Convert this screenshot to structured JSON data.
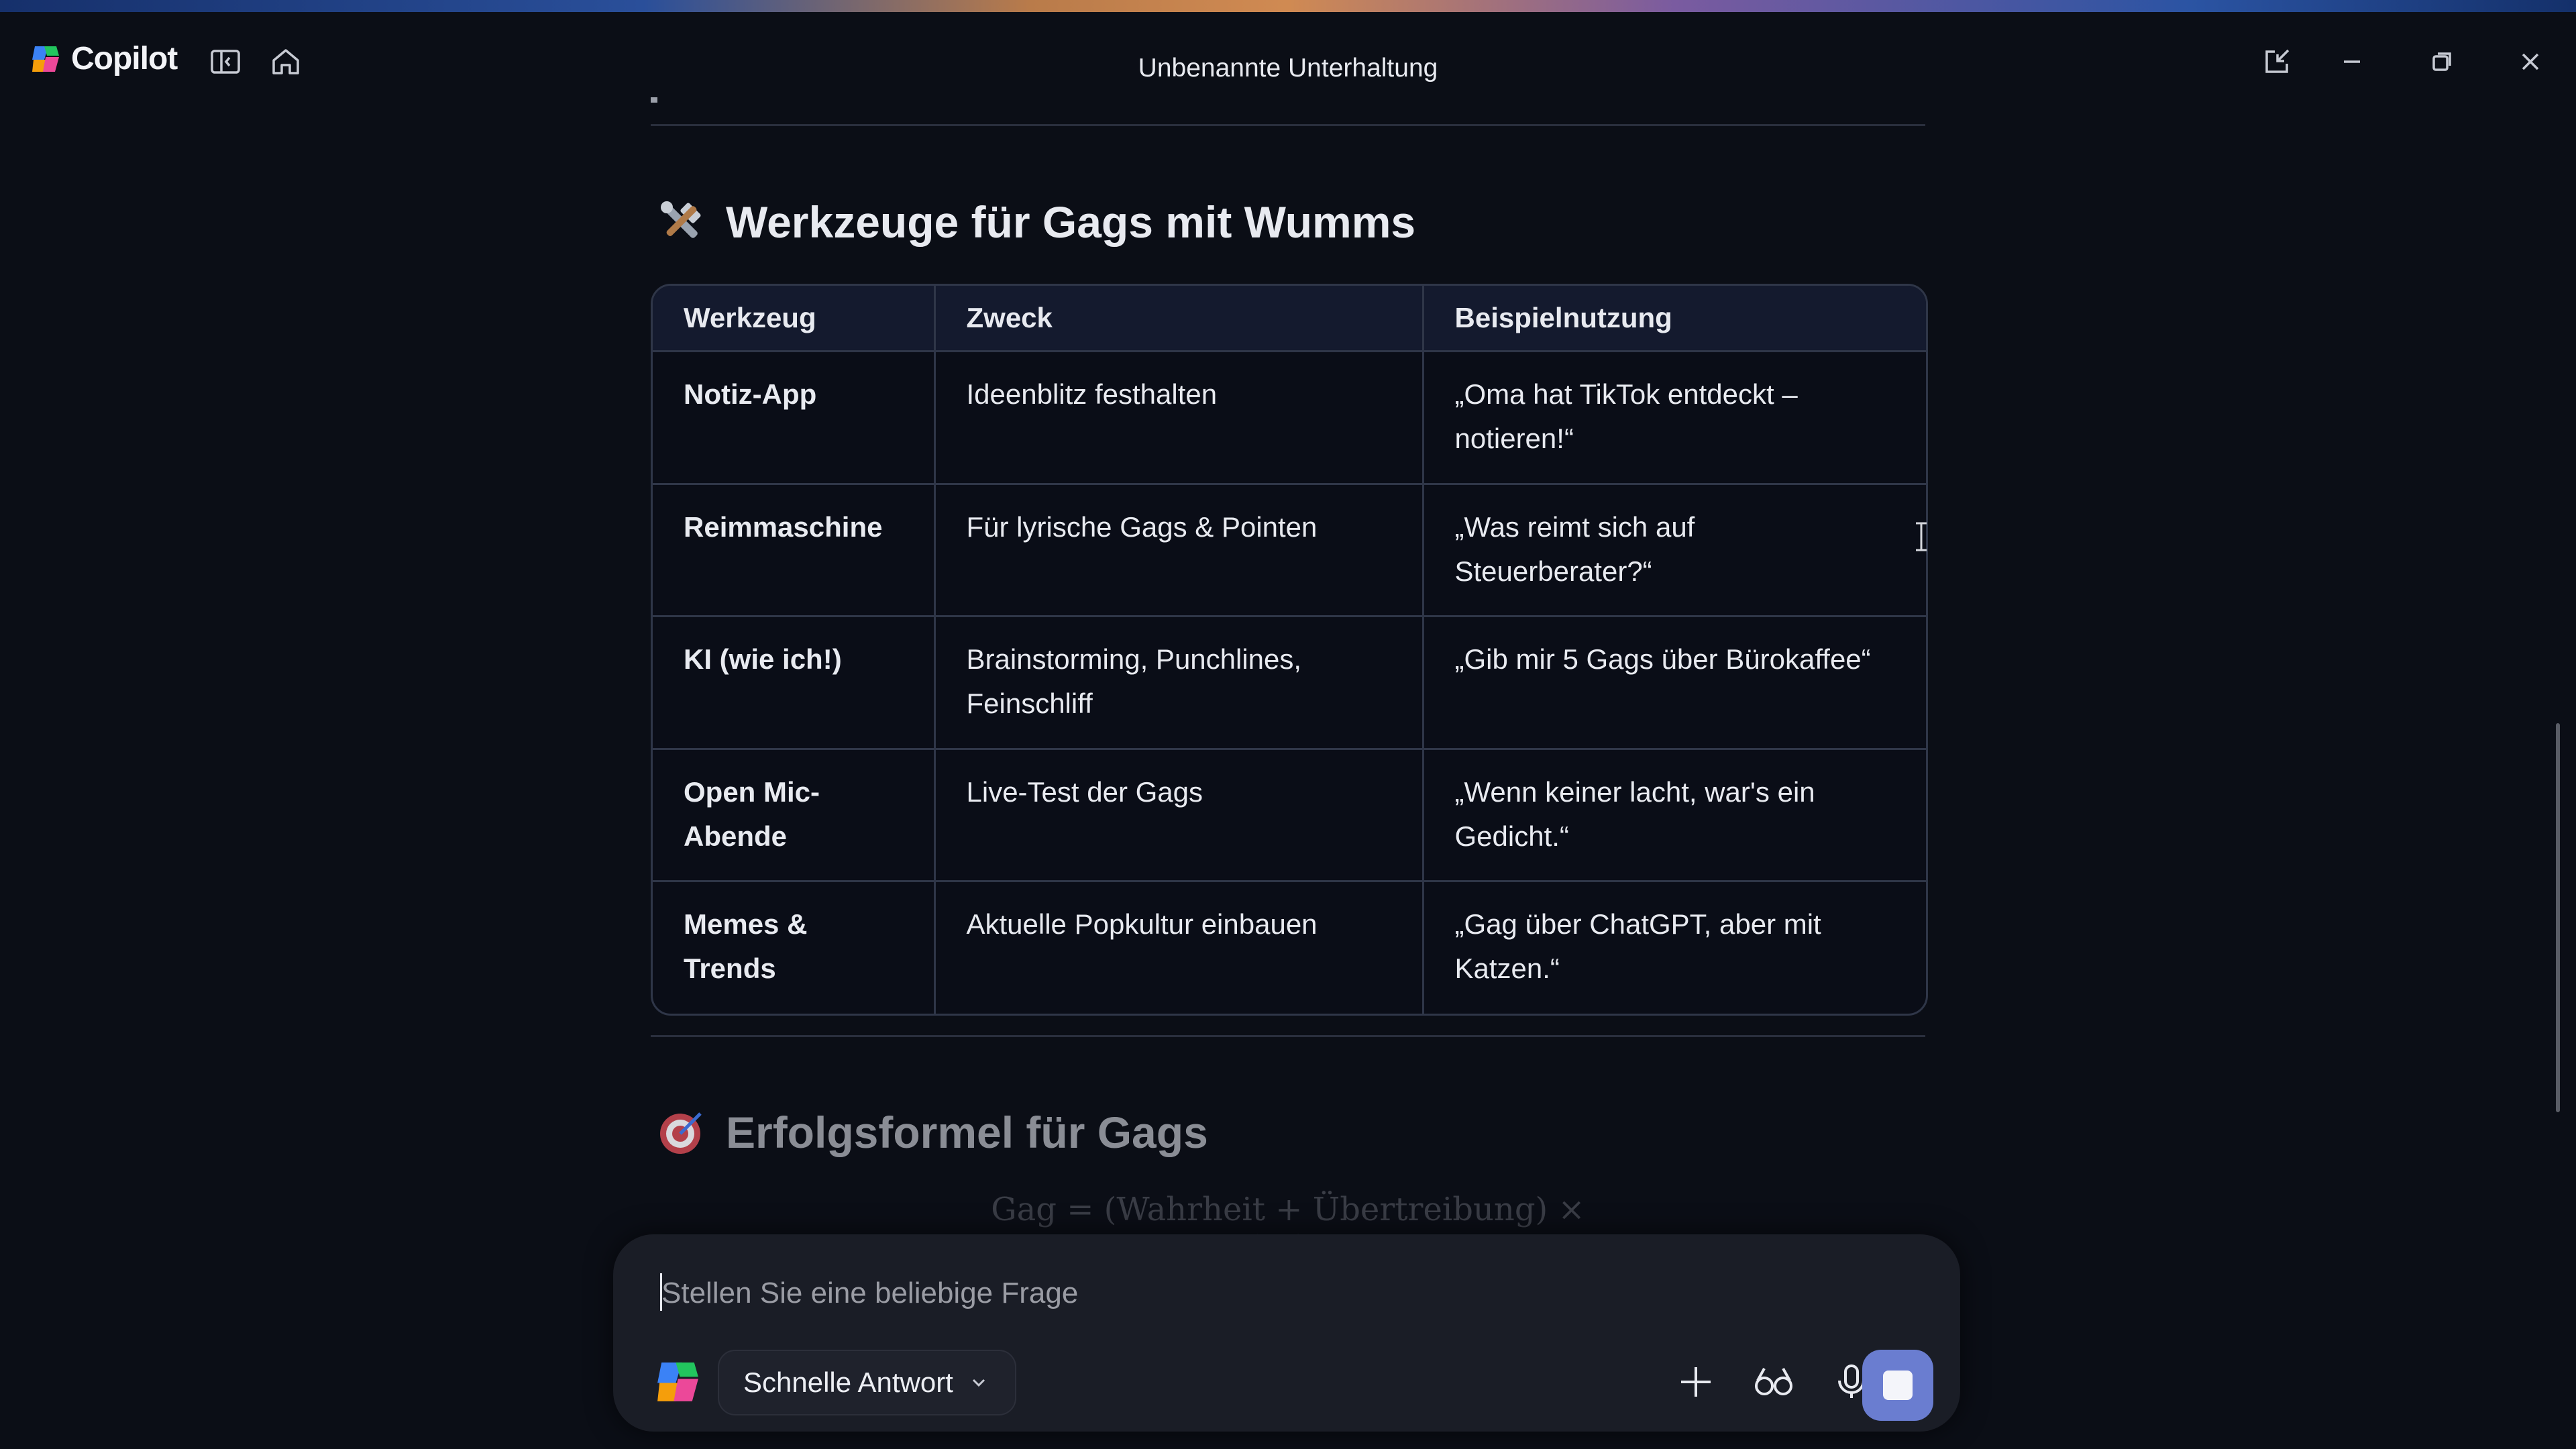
{
  "app": {
    "name": "Copilot",
    "window_title": "Unbenannte Unterhaltung"
  },
  "section_tools": {
    "heading": "Werkzeuge für Gags mit Wumms",
    "heading_icon": "hammer-wrench-icon",
    "table": {
      "headers": [
        "Werkzeug",
        "Zweck",
        "Beispielnutzung"
      ],
      "rows": [
        [
          "Notiz-App",
          "Ideenblitz festhalten",
          "„Oma hat TikTok entdeckt – notieren!“"
        ],
        [
          "Reimmaschine",
          "Für lyrische Gags & Pointen",
          "„Was reimt sich auf Steuerberater?“"
        ],
        [
          "KI (wie ich!)",
          "Brainstorming, Punchlines, Feinschliff",
          "„Gib mir 5 Gags über Bürokaffee“"
        ],
        [
          "Open Mic-Abende",
          "Live-Test der Gags",
          "„Wenn keiner lacht, war's ein Gedicht.“"
        ],
        [
          "Memes & Trends",
          "Aktuelle Popkultur einbauen",
          "„Gag über ChatGPT, aber mit Katzen.“"
        ]
      ]
    }
  },
  "section_formula": {
    "heading": "Erfolgsformel für Gags",
    "heading_icon": "target-dart-icon",
    "formula": "Gag = (Wahrheit + Übertreibung) × Timing"
  },
  "composer": {
    "placeholder": "Stellen Sie eine beliebige Frage",
    "mode_label": "Schnelle Antwort"
  },
  "colors": {
    "background": "#0b0e16",
    "table_header": "#141a2e",
    "send_button": "#6a7dd0"
  }
}
